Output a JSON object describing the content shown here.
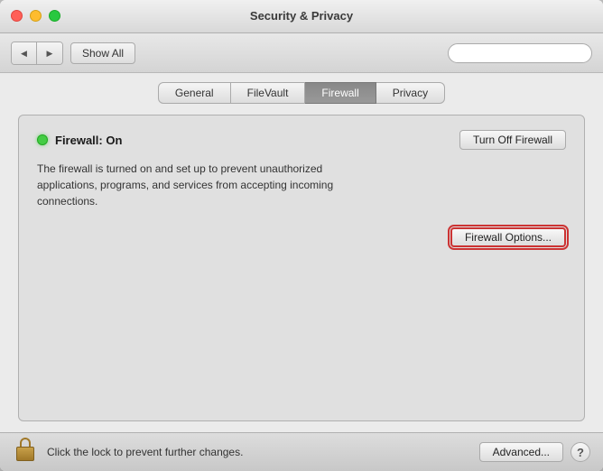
{
  "window": {
    "title": "Security & Privacy"
  },
  "toolbar": {
    "show_all_label": "Show All",
    "search_placeholder": ""
  },
  "tabs": [
    {
      "id": "general",
      "label": "General",
      "active": false
    },
    {
      "id": "filevault",
      "label": "FileVault",
      "active": false
    },
    {
      "id": "firewall",
      "label": "Firewall",
      "active": true
    },
    {
      "id": "privacy",
      "label": "Privacy",
      "active": false
    }
  ],
  "firewall": {
    "status_label": "Firewall: On",
    "turn_off_button": "Turn Off Firewall",
    "description": "The firewall is turned on and set up to prevent unauthorized applications, programs, and services from accepting incoming connections.",
    "options_button": "Firewall Options..."
  },
  "bottom_bar": {
    "lock_label": "Click the lock to prevent further changes.",
    "advanced_button": "Advanced...",
    "help_button": "?"
  }
}
